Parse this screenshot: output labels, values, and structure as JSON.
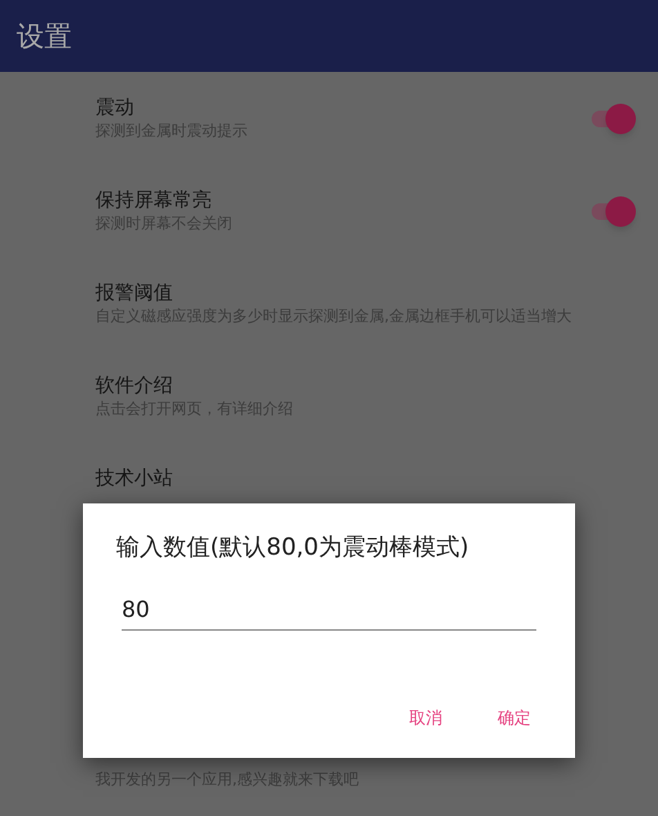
{
  "app_bar": {
    "title": "设置"
  },
  "settings": [
    {
      "title": "震动",
      "summary": "探测到金属时震动提示",
      "kind": "switch",
      "on": true
    },
    {
      "title": "保持屏幕常亮",
      "summary": "探测时屏幕不会关闭",
      "kind": "switch",
      "on": true
    },
    {
      "title": "报警阈值",
      "summary": "自定义磁感应强度为多少时显示探测到金属,金属边框手机可以适当增大",
      "kind": "text"
    },
    {
      "title": "软件介绍",
      "summary": "点击会打开网页，有详细介绍",
      "kind": "text"
    },
    {
      "title": "技术小站",
      "kind": "text"
    },
    {
      "summary": "我开发的另一个应用,感兴趣就来下载吧",
      "kind": "text"
    }
  ],
  "dialog": {
    "title": "输入数值(默认80,0为震动棒模式)",
    "input": {
      "value": "80"
    },
    "buttons": [
      "取消",
      "确定"
    ]
  }
}
